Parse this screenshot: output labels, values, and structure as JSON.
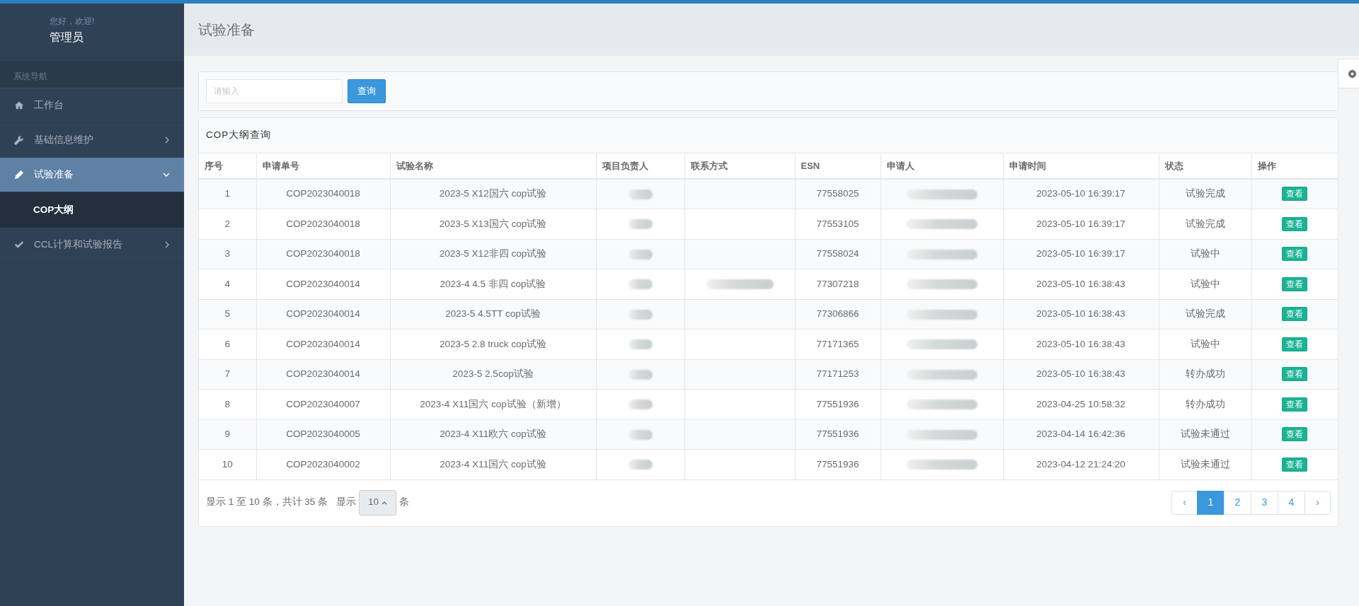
{
  "sidebar": {
    "greeting": "您好，欢迎!",
    "user": "管理员",
    "nav_header": "系统导航",
    "items": [
      {
        "label": "工作台",
        "has_children": false,
        "selected": false
      },
      {
        "label": "基础信息维护",
        "has_children": true,
        "expanded": false,
        "selected": false
      },
      {
        "label": "试验准备",
        "has_children": true,
        "expanded": true,
        "selected": true,
        "children": [
          {
            "label": "COP大纲",
            "selected": true
          }
        ]
      },
      {
        "label": "CCL计算和试验报告",
        "has_children": true,
        "expanded": false,
        "selected": false
      }
    ]
  },
  "page_title": "试验准备",
  "search": {
    "placeholder": "请输入",
    "button": "查询"
  },
  "panel_title": "COP大纲查询",
  "table": {
    "columns": [
      "序号",
      "申请单号",
      "试验名称",
      "项目负责人",
      "联系方式",
      "ESN",
      "申请人",
      "申请时间",
      "状态",
      "操作"
    ],
    "rows": [
      {
        "no": "1",
        "code": "COP2023040018",
        "name": "2023-5 X12国六 cop试验",
        "contact_redacted": false,
        "esn": "77558025",
        "time": "2023-05-10 16:39:17",
        "status": "试验完成",
        "action": "查看"
      },
      {
        "no": "2",
        "code": "COP2023040018",
        "name": "2023-5 X13国六 cop试验",
        "contact_redacted": false,
        "esn": "77553105",
        "time": "2023-05-10 16:39:17",
        "status": "试验完成",
        "action": "查看"
      },
      {
        "no": "3",
        "code": "COP2023040018",
        "name": "2023-5 X12非四 cop试验",
        "contact_redacted": false,
        "esn": "77558024",
        "time": "2023-05-10 16:39:17",
        "status": "试验中",
        "action": "查看"
      },
      {
        "no": "4",
        "code": "COP2023040014",
        "name": "2023-4 4.5 非四 cop试验",
        "contact_redacted": true,
        "esn": "77307218",
        "time": "2023-05-10 16:38:43",
        "status": "试验中",
        "action": "查看"
      },
      {
        "no": "5",
        "code": "COP2023040014",
        "name": "2023-5 4.5TT cop试验",
        "contact_redacted": false,
        "esn": "77306866",
        "time": "2023-05-10 16:38:43",
        "status": "试验完成",
        "action": "查看"
      },
      {
        "no": "6",
        "code": "COP2023040014",
        "name": "2023-5 2.8 truck cop试验",
        "contact_redacted": false,
        "esn": "77171365",
        "time": "2023-05-10 16:38:43",
        "status": "试验中",
        "action": "查看"
      },
      {
        "no": "7",
        "code": "COP2023040014",
        "name": "2023-5 2.5cop试验",
        "contact_redacted": false,
        "esn": "77171253",
        "time": "2023-05-10 16:38:43",
        "status": "转办成功",
        "action": "查看"
      },
      {
        "no": "8",
        "code": "COP2023040007",
        "name": "2023-4 X11国六 cop试验（新增）",
        "contact_redacted": false,
        "esn": "77551936",
        "time": "2023-04-25 10:58:32",
        "status": "转办成功",
        "action": "查看"
      },
      {
        "no": "9",
        "code": "COP2023040005",
        "name": "2023-4 X11欧六 cop试验",
        "contact_redacted": false,
        "esn": "77551936",
        "time": "2023-04-14 16:42:36",
        "status": "试验未通过",
        "action": "查看"
      },
      {
        "no": "10",
        "code": "COP2023040002",
        "name": "2023-4 X11国六 cop试验",
        "contact_redacted": false,
        "esn": "77551936",
        "time": "2023-04-12 21:24:20",
        "status": "试验未通过",
        "action": "查看"
      }
    ]
  },
  "footer": {
    "summary": "显示 1 至 10 条，共计 35 条",
    "show_label": "显示",
    "page_size": "10",
    "unit": "条"
  },
  "pagination": [
    {
      "label": "‹",
      "selected": false
    },
    {
      "label": "1",
      "selected": true
    },
    {
      "label": "2",
      "selected": false
    },
    {
      "label": "3",
      "selected": false
    },
    {
      "label": "4",
      "selected": false
    },
    {
      "label": "›",
      "selected": false
    }
  ]
}
